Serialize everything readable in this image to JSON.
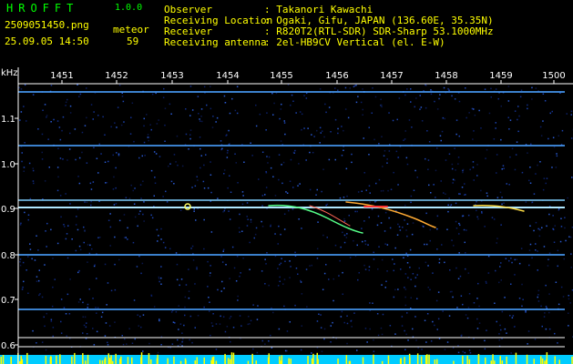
{
  "app": {
    "title": "HROFFT",
    "version": "1.0.0"
  },
  "file": {
    "name": "2509051450.png",
    "datetime": "25.09.05 14:50"
  },
  "counter": {
    "label": "meteor",
    "value": "59"
  },
  "station": {
    "observer_label": "Observer",
    "observer_value": ": Takanori Kawachi",
    "location_label": "Receiving Location",
    "location_value": ": Ogaki, Gifu, JAPAN (136.60E, 35.35N)",
    "receiver_label": "Receiver",
    "receiver_value": ": R820T2(RTL-SDR) SDR-Sharp 53.1000MHz",
    "antenna_label": "Receiving antenna",
    "antenna_value": ": 2el-HB9CV Vertical (el. E-W)"
  },
  "axis": {
    "y_unit": "kHz",
    "x_ticks": [
      "1451",
      "1452",
      "1453",
      "1454",
      "1455",
      "1456",
      "1457",
      "1458",
      "1459",
      "1500"
    ],
    "y_ticks": [
      "1.1",
      "1.0",
      "0.9",
      "0.8",
      "0.7",
      "0.6"
    ]
  },
  "colors": {
    "background": "#000000",
    "text": "#ffffff",
    "accent": "#00ff00",
    "counter": "#ffff00",
    "noise": "#0a1c5a",
    "bottom_bar": "#00ccff"
  }
}
